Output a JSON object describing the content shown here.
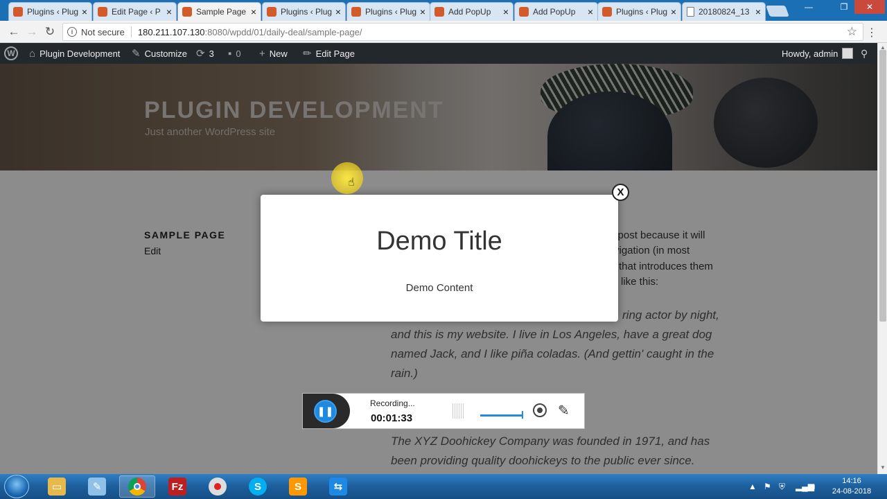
{
  "browser": {
    "tabs": [
      {
        "label": "Plugins ‹ Plug",
        "icon": "wordpress-icon",
        "active": false
      },
      {
        "label": "Edit Page ‹ P",
        "icon": "wordpress-icon",
        "active": false
      },
      {
        "label": "Sample Page",
        "icon": "wordpress-icon",
        "active": true
      },
      {
        "label": "Plugins ‹ Plug",
        "icon": "wordpress-icon",
        "active": false
      },
      {
        "label": "Plugins ‹ Plug",
        "icon": "wordpress-icon",
        "active": false
      },
      {
        "label": "Add PopUp",
        "icon": "wordpress-icon",
        "active": false
      },
      {
        "label": "Add PopUp",
        "icon": "wordpress-icon",
        "active": false
      },
      {
        "label": "Plugins ‹ Plug",
        "icon": "wordpress-icon",
        "active": false
      },
      {
        "label": "20180824_13",
        "icon": "document-icon",
        "active": false
      }
    ],
    "security_label": "Not secure",
    "url_host": "180.211.107.130",
    "url_path": ":8080/wpdd/01/daily-deal/sample-page/"
  },
  "adminbar": {
    "site_name": "Plugin Development",
    "customize": "Customize",
    "updates_count": "3",
    "comments_count": "0",
    "new_label": "New",
    "edit_page": "Edit Page",
    "greeting": "Howdy, admin"
  },
  "site": {
    "title": "PLUGIN DEVELOPMENT",
    "tagline": "Just another WordPress site"
  },
  "page": {
    "title": "SAMPLE PAGE",
    "edit_link": "Edit",
    "paragraph_lines": [
      "g post because it will",
      "vigation (in most",
      "that introduces them",
      "like this:"
    ],
    "quote1_lines": [
      "ring actor by night,",
      "and this is my website. I live in Los Angeles, have a great dog",
      "named Jack, and I like piña coladas. (And gettin' caught in the",
      "rain.)"
    ],
    "quote2_lines": [
      "The XYZ Doohickey Company was founded in 1971, and has",
      "been providing quality doohickeys to the public ever since."
    ]
  },
  "popup": {
    "title": "Demo Title",
    "content": "Demo Content",
    "close_label": "X"
  },
  "recorder": {
    "status": "Recording...",
    "elapsed": "00:01:33"
  },
  "taskbar": {
    "time": "14:16",
    "date": "24-08-2018"
  },
  "colors": {
    "adminbar_bg": "#23282d",
    "taskbar_bg": "#1c5e9c",
    "recorder_accent": "#1f8ae0"
  }
}
